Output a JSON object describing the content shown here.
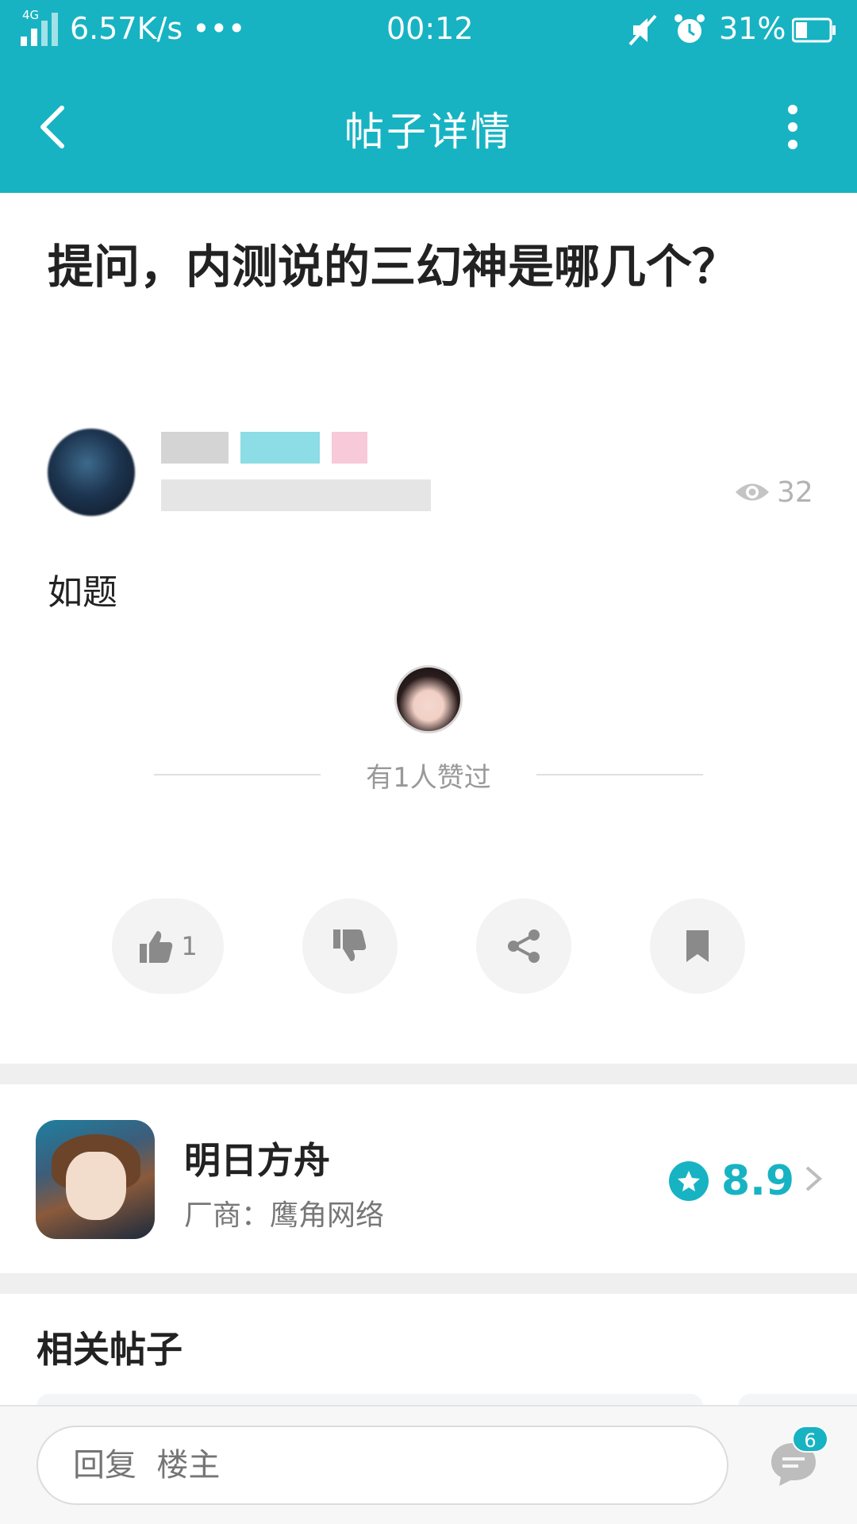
{
  "status_bar": {
    "network": "4G",
    "speed": "6.57K/s •••",
    "time": "00:12",
    "battery": "31%"
  },
  "header": {
    "title": "帖子详情",
    "back_icon": "chevron-left-icon",
    "more_icon": "more-vertical-icon"
  },
  "post": {
    "title": "提问，内测说的三幻神是哪几个？",
    "body": "如题",
    "views": "32",
    "liked_text": "有1人赞过"
  },
  "actions": {
    "like_count": "1",
    "icons": [
      "thumbs-up-icon",
      "thumbs-down-icon",
      "share-icon",
      "bookmark-icon"
    ]
  },
  "game": {
    "name": "明日方舟",
    "maker": "厂商：鹰角网络",
    "rating": "8.9"
  },
  "related": {
    "title": "相关帖子"
  },
  "reply": {
    "placeholder": "回复  楼主",
    "comment_count": "6"
  },
  "colors": {
    "accent": "#17b3c3",
    "header_bg": "#17b3c3",
    "muted_text": "#999999"
  }
}
